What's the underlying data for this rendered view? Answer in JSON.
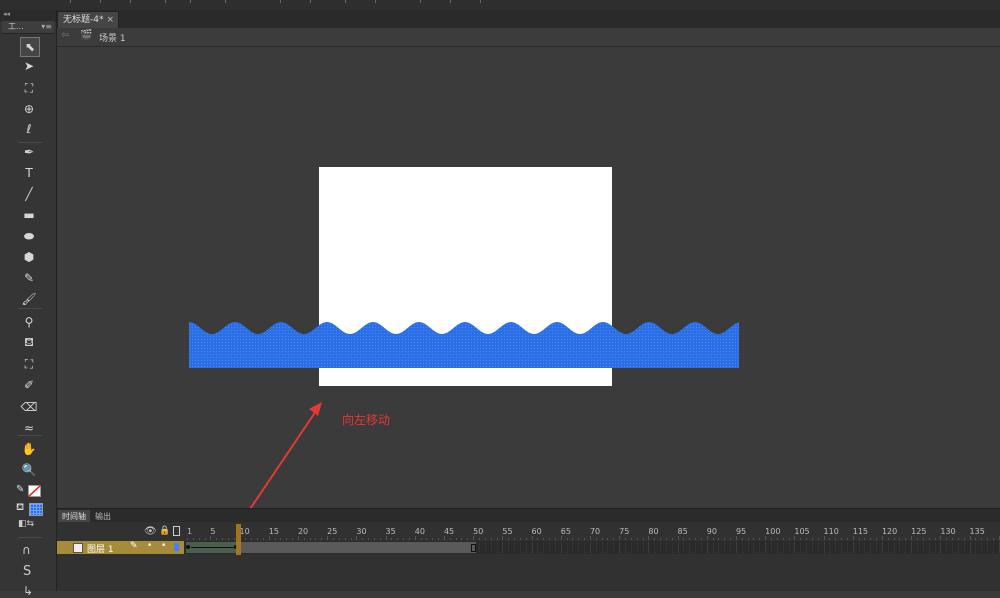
{
  "document": {
    "tab_title": "无标题-4*",
    "tab_close": "×",
    "scene_label": "场景 1"
  },
  "tools_panel": {
    "title": "工...",
    "tools": [
      {
        "name": "selection-tool",
        "glyph": "⬉"
      },
      {
        "name": "subselection-tool",
        "glyph": "➤"
      },
      {
        "name": "free-transform-tool",
        "glyph": "⛶"
      },
      {
        "name": "3d-rotation-tool",
        "glyph": "⊕"
      },
      {
        "name": "lasso-tool",
        "glyph": "ℓ"
      },
      {
        "name": "pen-tool",
        "glyph": "✒"
      },
      {
        "name": "text-tool",
        "glyph": "T"
      },
      {
        "name": "line-tool",
        "glyph": "╱"
      },
      {
        "name": "rectangle-tool",
        "glyph": "▬"
      },
      {
        "name": "oval-tool",
        "glyph": "⬬"
      },
      {
        "name": "polystar-tool",
        "glyph": "⬢"
      },
      {
        "name": "pencil-tool",
        "glyph": "✎"
      },
      {
        "name": "brush-tool",
        "glyph": "🖌"
      },
      {
        "name": "bone-tool",
        "glyph": "⚲"
      },
      {
        "name": "paint-bucket-tool",
        "glyph": "⛾"
      },
      {
        "name": "ink-bottle-tool",
        "glyph": "⛶"
      },
      {
        "name": "eyedropper-tool",
        "glyph": "✐"
      },
      {
        "name": "eraser-tool",
        "glyph": "⌫"
      },
      {
        "name": "width-tool",
        "glyph": "≈"
      },
      {
        "name": "hand-tool",
        "glyph": "✋"
      },
      {
        "name": "zoom-tool",
        "glyph": "🔍"
      }
    ]
  },
  "stage": {
    "background_color": "#ffffff",
    "wave_color": "#2b6fe6"
  },
  "annotation": {
    "text": "向左移动",
    "color": "#e53935"
  },
  "timeline": {
    "tabs": [
      "时间轴",
      "输出"
    ],
    "layer_name": "图层 1",
    "ruler_labels": [
      "1",
      "5",
      "10",
      "15",
      "20",
      "25",
      "30",
      "35",
      "40",
      "45",
      "50",
      "55",
      "60",
      "65",
      "70",
      "75",
      "80",
      "85",
      "90",
      "95",
      "100",
      "105",
      "110",
      "115",
      "120",
      "125",
      "130",
      "135"
    ],
    "current_frame": 10,
    "tween_end_frame": 10,
    "last_frame": 50
  }
}
